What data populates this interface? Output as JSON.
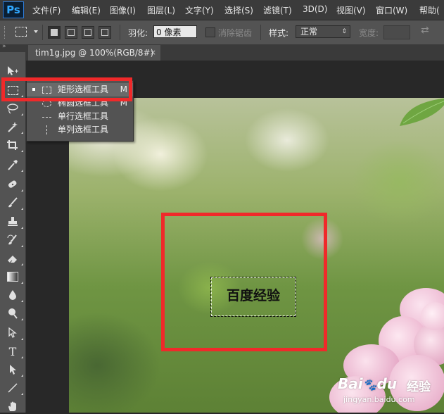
{
  "app": {
    "logo": "Ps"
  },
  "menu": [
    "文件(F)",
    "编辑(E)",
    "图像(I)",
    "图层(L)",
    "文字(Y)",
    "选择(S)",
    "滤镜(T)",
    "3D(D)",
    "视图(V)",
    "窗口(W)",
    "帮助("
  ],
  "options": {
    "feather_label": "羽化:",
    "feather_value": "0 像素",
    "antialias_label": "消除锯齿",
    "style_label": "样式:",
    "style_value": "正常",
    "width_label": "宽度:"
  },
  "document_tab": {
    "title": "tim1g.jpg @ 100%(RGB/8#) *",
    "close": "×"
  },
  "tool_flyout": {
    "items": [
      {
        "label": "矩形选框工具",
        "shortcut": "M",
        "selected": true,
        "icon": "rect-marquee-icon"
      },
      {
        "label": "椭圆选框工具",
        "shortcut": "M",
        "selected": false,
        "icon": "ellipse-marquee-icon"
      },
      {
        "label": "单行选框工具",
        "shortcut": "",
        "selected": false,
        "icon": "single-row-marquee-icon"
      },
      {
        "label": "单列选框工具",
        "shortcut": "",
        "selected": false,
        "icon": "single-column-marquee-icon"
      }
    ]
  },
  "canvas": {
    "selection_text": "百度经验"
  },
  "watermark": {
    "logo": "Bai",
    "logo2": "经验",
    "url": "jingyan.baidu.com"
  },
  "colors": {
    "highlight": "#f0292a",
    "ui_dark": "#535353",
    "menubar": "#3b3b3b"
  }
}
